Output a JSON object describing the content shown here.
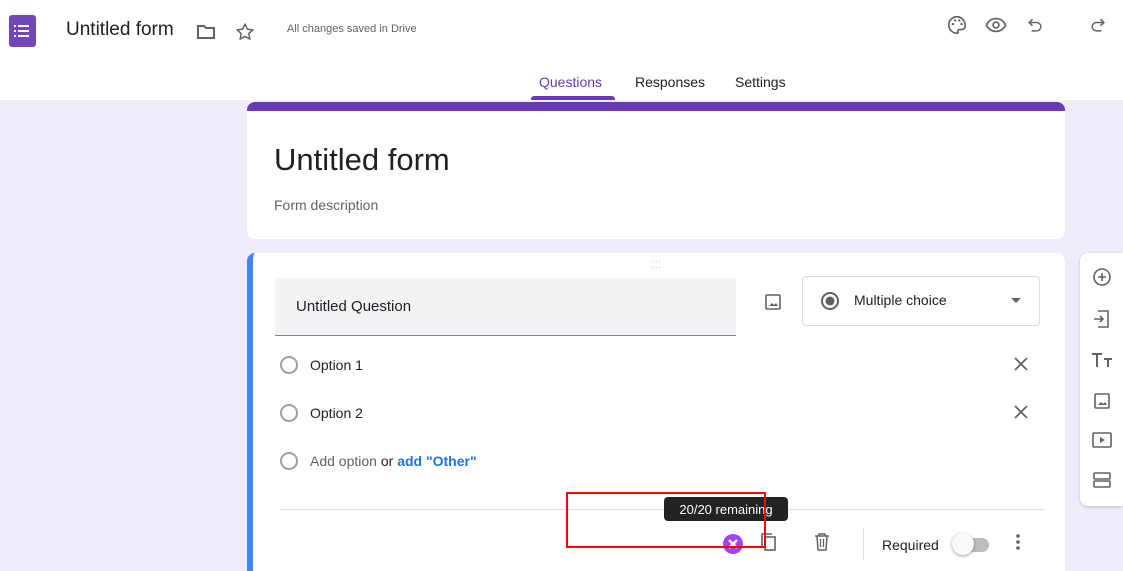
{
  "header": {
    "title": "Untitled form",
    "saved_status": "All changes saved in Drive",
    "icons": [
      "forms-logo-icon",
      "folder-icon",
      "star-icon",
      "palette-icon",
      "eye-icon",
      "undo-icon",
      "redo-icon"
    ]
  },
  "tabs": [
    {
      "label": "Questions",
      "active": true
    },
    {
      "label": "Responses",
      "active": false
    },
    {
      "label": "Settings",
      "active": false
    }
  ],
  "form": {
    "title": "Untitled form",
    "description_placeholder": "Form description"
  },
  "question": {
    "title": "Untitled Question",
    "type": "Multiple choice",
    "options": [
      "Option 1",
      "Option 2"
    ],
    "add_option": "Add option",
    "or": "or",
    "add_other": "add \"Other\"",
    "required_label": "Required",
    "required": false
  },
  "tooltip": {
    "text": "20/20 remaining"
  },
  "side_toolbar": {
    "icons": [
      "add-question-icon",
      "import-questions-icon",
      "add-title-icon",
      "add-image-icon",
      "add-video-icon",
      "add-section-icon"
    ]
  },
  "colors": {
    "accent": "#673ab7",
    "background": "#f0ebf8",
    "active_card_border": "#4285f4",
    "annotation": "#ff0000"
  }
}
